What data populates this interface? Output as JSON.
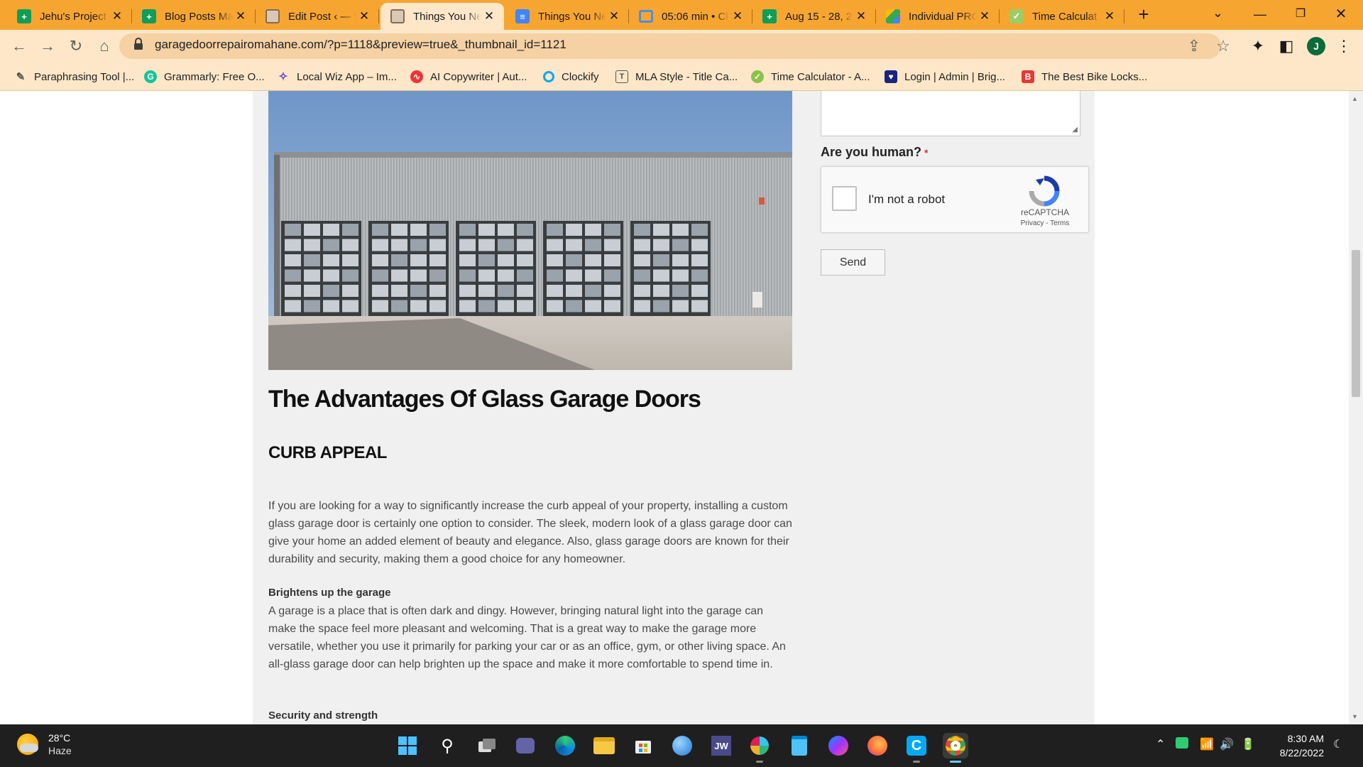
{
  "browser": {
    "tabs": [
      {
        "title": "Jehu's Project",
        "icon": "google-sheets-icon",
        "active": false
      },
      {
        "title": "Blog Posts Ma",
        "icon": "google-sheets-icon",
        "active": false
      },
      {
        "title": "Edit Post ‹ — V",
        "icon": "wordpress-site-icon",
        "active": false
      },
      {
        "title": "Things You Ne",
        "icon": "wordpress-site-icon",
        "active": true
      },
      {
        "title": "Things You Ne",
        "icon": "google-docs-icon",
        "active": false
      },
      {
        "title": "05:06 min • Cl",
        "icon": "clockify-icon",
        "active": false
      },
      {
        "title": "Aug 15 - 28, 2",
        "icon": "google-sheets-icon",
        "active": false
      },
      {
        "title": "Individual PRC",
        "icon": "google-drive-icon",
        "active": false
      },
      {
        "title": "Time Calculat",
        "icon": "time-calculator-icon",
        "active": false
      }
    ],
    "url": "garagedoorrepairomahane.com/?p=1118&preview=true&_thumbnail_id=1121",
    "profile_initial": "J",
    "bookmarks": [
      {
        "label": "Paraphrasing Tool |...",
        "icon": "quill-icon"
      },
      {
        "label": "Grammarly: Free O...",
        "icon": "grammarly-icon"
      },
      {
        "label": "Local Wiz App – Im...",
        "icon": "wizard-icon"
      },
      {
        "label": "AI Copywriter | Aut...",
        "icon": "ai-copywriter-icon"
      },
      {
        "label": "Clockify",
        "icon": "clockify-icon"
      },
      {
        "label": "MLA Style - Title Ca...",
        "icon": "title-case-icon"
      },
      {
        "label": "Time Calculator - A...",
        "icon": "time-calculator-icon"
      },
      {
        "label": "Login | Admin | Brig...",
        "icon": "admin-icon"
      },
      {
        "label": "The Best Bike Locks...",
        "icon": "bike-locks-icon"
      }
    ],
    "accent_color": "#f7a531"
  },
  "article": {
    "heading": "The Advantages Of Glass Garage Doors",
    "subheading": "CURB APPEAL",
    "paragraph_1": "If you are looking for a way to significantly increase the curb appeal of your property, installing a custom glass garage door is certainly one option to consider. The sleek, modern look of a glass garage door can give your home an added element of beauty and elegance. Also, glass garage doors are known for their durability and security, making them a good choice for any homeowner.",
    "section_2_title": "Brightens up the garage",
    "paragraph_2": "A garage is a place that is often dark and dingy. However, bringing natural light into the garage can make the space feel more pleasant and welcoming. That is a great way to make the garage more versatile, whether you use it primarily for parking your car or as an office, gym, or other living space. An all-glass garage door can help brighten up the space and make it more comfortable to spend time in.",
    "section_3_title": "Security and strength"
  },
  "sidebar": {
    "human_label": "Are you human?",
    "required_mark": "*",
    "captcha_label": "I'm not a robot",
    "captcha_brand": "reCAPTCHA",
    "captcha_terms": "Privacy - Terms",
    "send_label": "Send"
  },
  "taskbar": {
    "temperature": "28°C",
    "condition": "Haze",
    "time": "8:30 AM",
    "date": "8/22/2022"
  }
}
